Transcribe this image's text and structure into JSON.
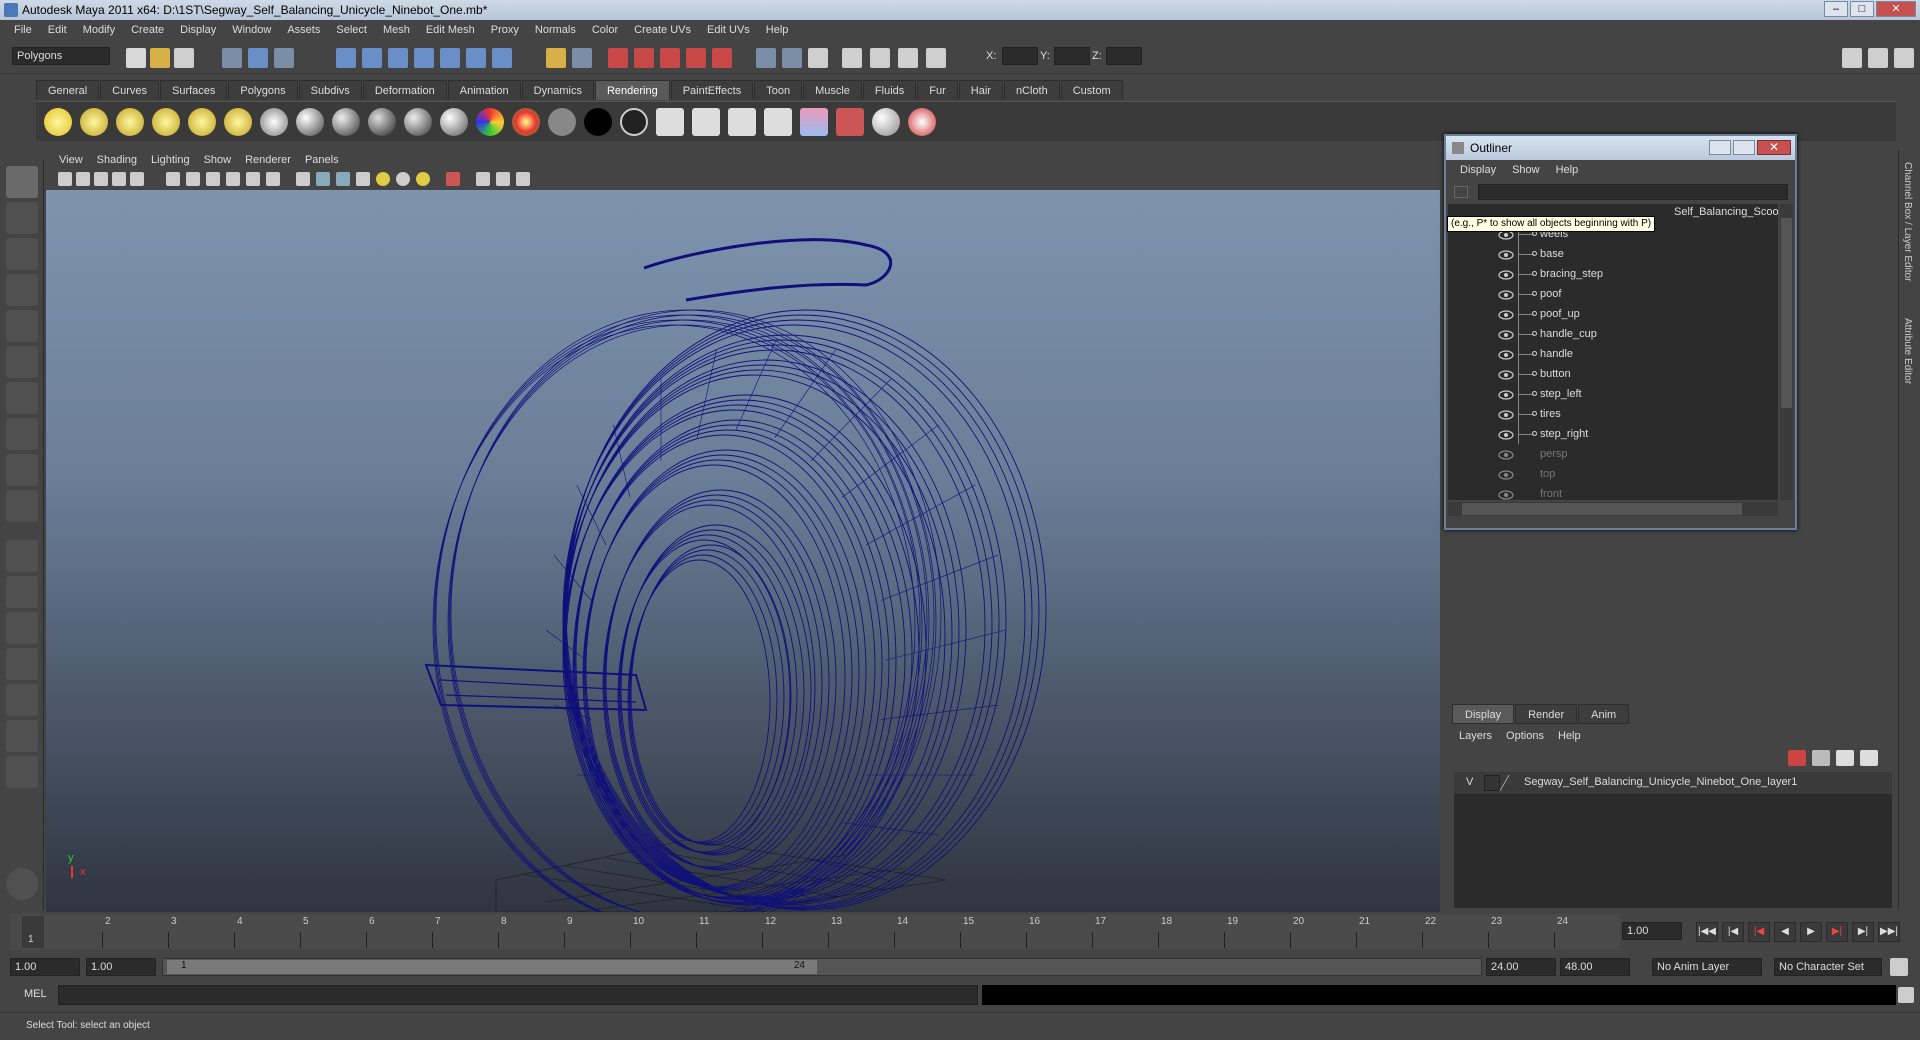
{
  "window": {
    "title": "Autodesk Maya 2011 x64: D:\\1ST\\Segway_Self_Balancing_Unicycle_Ninebot_One.mb*"
  },
  "menubar": [
    "File",
    "Edit",
    "Modify",
    "Create",
    "Display",
    "Window",
    "Assets",
    "Select",
    "Mesh",
    "Edit Mesh",
    "Proxy",
    "Normals",
    "Color",
    "Create UVs",
    "Edit UVs",
    "Help"
  ],
  "status_line": {
    "menu_set": "Polygons",
    "x_label": "X:",
    "y_label": "Y:",
    "z_label": "Z:"
  },
  "shelf_tabs": [
    "General",
    "Curves",
    "Surfaces",
    "Polygons",
    "Subdivs",
    "Deformation",
    "Animation",
    "Dynamics",
    "Rendering",
    "PaintEffects",
    "Toon",
    "Muscle",
    "Fluids",
    "Fur",
    "Hair",
    "nCloth",
    "Custom"
  ],
  "active_shelf_tab": "Rendering",
  "viewport": {
    "menu": [
      "View",
      "Shading",
      "Lighting",
      "Show",
      "Renderer",
      "Panels"
    ],
    "axis_y": "y",
    "axis_x": "x",
    "wire_color": "#10107a"
  },
  "outliner": {
    "title": "Outliner",
    "menu": [
      "Display",
      "Show",
      "Help"
    ],
    "tooltip": "(e.g., P* to show all objects beginning with P)",
    "root_partial": "Self_Balancing_Scoo",
    "items": [
      {
        "label": "weels",
        "dim": false
      },
      {
        "label": "base",
        "dim": false
      },
      {
        "label": "bracing_step",
        "dim": false
      },
      {
        "label": "poof",
        "dim": false
      },
      {
        "label": "poof_up",
        "dim": false
      },
      {
        "label": "handle_cup",
        "dim": false
      },
      {
        "label": "handle",
        "dim": false
      },
      {
        "label": "button",
        "dim": false
      },
      {
        "label": "step_left",
        "dim": false
      },
      {
        "label": "tires",
        "dim": false
      },
      {
        "label": "step_right",
        "dim": false
      },
      {
        "label": "persp",
        "dim": true
      },
      {
        "label": "top",
        "dim": true
      },
      {
        "label": "front",
        "dim": true
      }
    ]
  },
  "side_tabs": {
    "channel_box": "Channel Box / Layer Editor",
    "attribute_editor": "Attribute Editor"
  },
  "layer_editor": {
    "tabs": [
      "Display",
      "Render",
      "Anim"
    ],
    "active_tab": "Display",
    "menu": [
      "Layers",
      "Options",
      "Help"
    ],
    "layer": {
      "visible": "V",
      "name": "Segway_Self_Balancing_Unicycle_Ninebot_One_layer1"
    }
  },
  "timeline": {
    "ticks": [
      "1",
      "2",
      "3",
      "4",
      "5",
      "6",
      "7",
      "8",
      "9",
      "10",
      "11",
      "12",
      "13",
      "14",
      "15",
      "16",
      "17",
      "18",
      "19",
      "20",
      "21",
      "22",
      "23",
      "24"
    ],
    "current_frame": "1",
    "current_time_field": "1.00"
  },
  "range": {
    "start_time": "1.00",
    "playback_start": "1.00",
    "range_start_label": "1",
    "range_end_label": "24",
    "playback_end": "24.00",
    "end_time": "48.00",
    "anim_layer": "No Anim Layer",
    "character_set": "No Character Set"
  },
  "command_line": {
    "label": "MEL"
  },
  "help_line": {
    "text": "Select Tool: select an object"
  }
}
